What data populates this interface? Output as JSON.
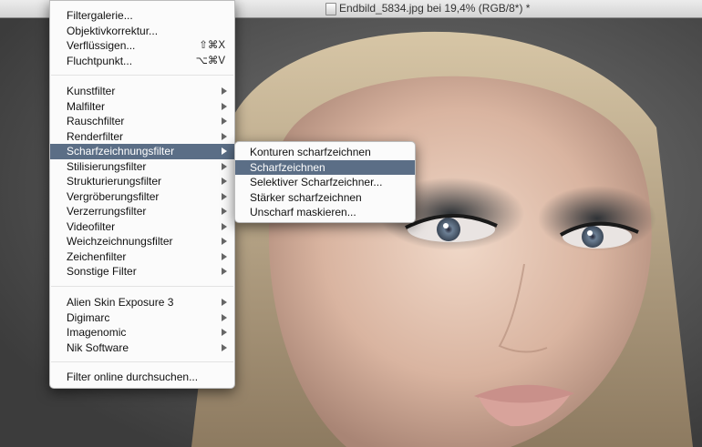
{
  "window": {
    "title": "Endbild_5834.jpg bei 19,4% (RGB/8*) *"
  },
  "icons": {
    "document": "document-icon",
    "submenu": "chevron-right-icon"
  },
  "colors": {
    "highlight": "#5b6e86",
    "menu_bg": "#fbfbfb"
  },
  "filter_menu": {
    "group1": [
      {
        "label": "Filtergalerie...",
        "shortcut": ""
      },
      {
        "label": "Objektivkorrektur...",
        "shortcut": ""
      },
      {
        "label": "Verflüssigen...",
        "shortcut": "⇧⌘X"
      },
      {
        "label": "Fluchtpunkt...",
        "shortcut": "⌥⌘V"
      }
    ],
    "group2": [
      "Kunstfilter",
      "Malfilter",
      "Rauschfilter",
      "Renderfilter",
      "Scharfzeichnungsfilter",
      "Stilisierungsfilter",
      "Strukturierungsfilter",
      "Vergröberungsfilter",
      "Verzerrungsfilter",
      "Videofilter",
      "Weichzeichnungsfilter",
      "Zeichenfilter",
      "Sonstige Filter"
    ],
    "group3": [
      "Alien Skin Exposure 3",
      "Digimarc",
      "Imagenomic",
      "Nik Software"
    ],
    "group4": [
      "Filter online durchsuchen..."
    ],
    "active_item": "Scharfzeichnungsfilter"
  },
  "sharpen_submenu": {
    "items": [
      "Konturen scharfzeichnen",
      "Scharfzeichnen",
      "Selektiver Scharfzeichner...",
      "Stärker scharfzeichnen",
      "Unscharf maskieren..."
    ],
    "highlighted_item": "Scharfzeichnen"
  }
}
